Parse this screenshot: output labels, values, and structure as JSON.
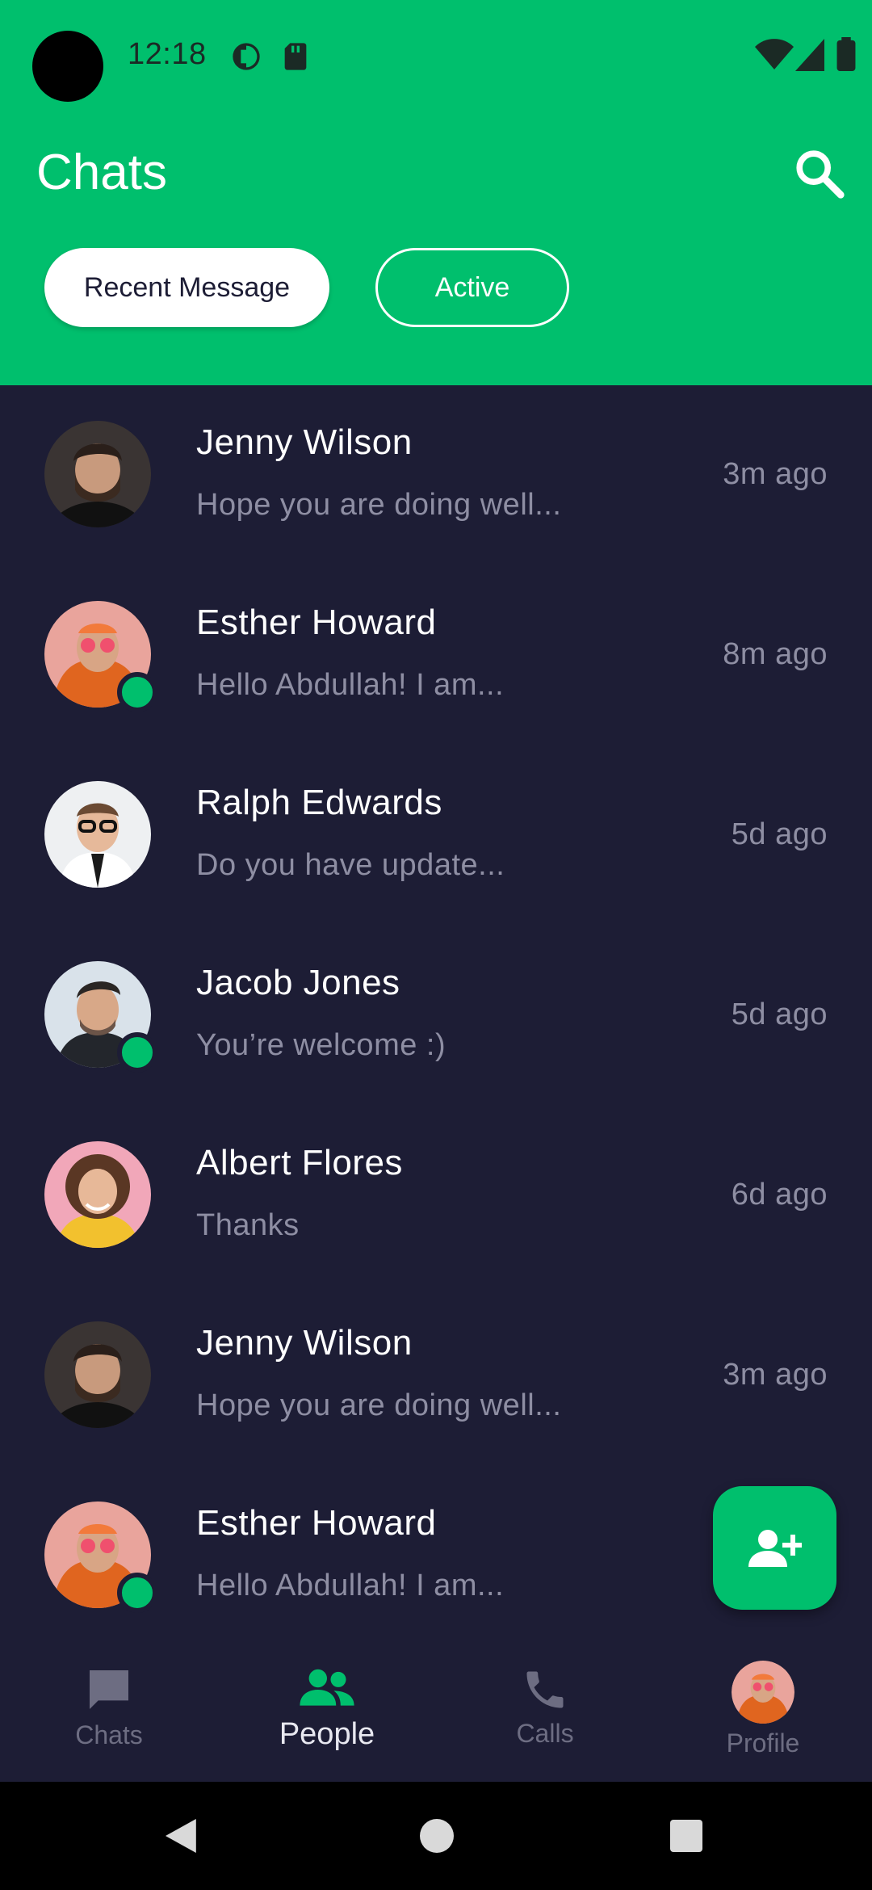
{
  "status_bar": {
    "time": "12:18"
  },
  "header": {
    "title": "Chats",
    "filters": {
      "recent": "Recent Message",
      "active": "Active"
    }
  },
  "chats": [
    {
      "name": "Jenny Wilson",
      "message": "Hope you are doing well...",
      "time": "3m ago",
      "online": false,
      "avatar": "bearded-man"
    },
    {
      "name": "Esther Howard",
      "message": "Hello Abdullah! I am...",
      "time": "8m ago",
      "online": true,
      "avatar": "orange-hoodie-man"
    },
    {
      "name": "Ralph Edwards",
      "message": "Do you have update...",
      "time": "5d ago",
      "online": false,
      "avatar": "glasses-man"
    },
    {
      "name": "Jacob Jones",
      "message": "You’re welcome :)",
      "time": "5d ago",
      "online": true,
      "avatar": "stubble-man"
    },
    {
      "name": "Albert Flores",
      "message": "Thanks",
      "time": "6d ago",
      "online": false,
      "avatar": "curly-woman"
    },
    {
      "name": "Jenny Wilson",
      "message": "Hope you are doing well...",
      "time": "3m ago",
      "online": false,
      "avatar": "bearded-man"
    },
    {
      "name": "Esther Howard",
      "message": "Hello Abdullah! I am...",
      "time": "",
      "online": true,
      "avatar": "orange-hoodie-man"
    }
  ],
  "fab": {
    "icon": "add-person-icon"
  },
  "bottom_nav": {
    "chats": "Chats",
    "people": "People",
    "calls": "Calls",
    "profile": "Profile",
    "active": "people"
  },
  "colors": {
    "primary": "#00bf6d",
    "background": "#1d1d35",
    "muted_text": "#8e8ea3"
  }
}
